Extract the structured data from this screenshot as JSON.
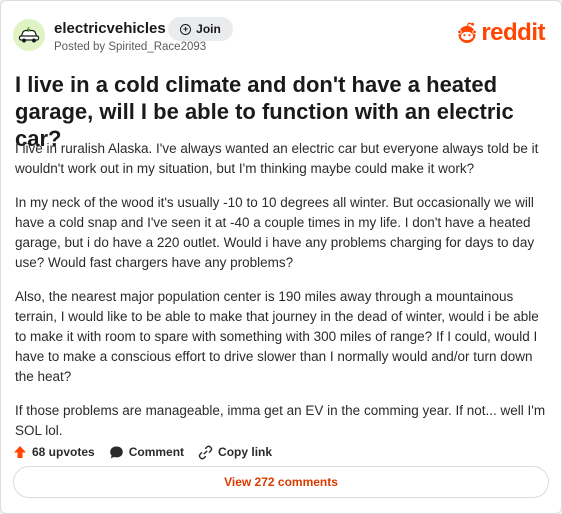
{
  "header": {
    "subreddit": "electricvehicles",
    "posted_by": "Posted by Spirited_Race2093",
    "join_label": "Join",
    "brand_word": "reddit"
  },
  "post": {
    "title": "I live in a cold climate and don't have a heated garage, will I be able to function with an electric car?",
    "paragraphs": [
      "I live in ruralish Alaska. I've always wanted an electric car but everyone always told be it wouldn't work out in my situation, but I'm thinking maybe could make it work?",
      "In my neck of the wood it's usually -10 to 10 degrees all winter. But occasionally we will have a cold snap and I've seen it at -40 a couple times in my life. I don't have a heated garage, but i do have a 220 outlet. Would i have any problems charging for days to day use? Would fast chargers have any problems?",
      "Also, the nearest major population center is 190 miles away through a mountainous terrain, I would like to be able to make that journey in the dead of winter, would i be able to make it with room to spare with something with 300 miles of range? If I could, would I have to make a conscious effort to drive slower than I normally would and/or turn down the heat?",
      "If those problems are manageable, imma get an EV in the comming year. If not... well I'm SOL lol."
    ]
  },
  "actions": {
    "upvotes_label": "68 upvotes",
    "comment_label": "Comment",
    "copy_link_label": "Copy link",
    "view_comments_label": "View 272 comments"
  },
  "colors": {
    "brand": "#ff4500",
    "upvote": "#ff4500",
    "view_comments": "#d93a00"
  },
  "icons": {
    "avatar": "ev-car-icon",
    "join": "plus-circle-icon",
    "brand": "reddit-alien-icon",
    "upvote": "upvote-arrow-icon",
    "comment": "comment-bubble-icon",
    "copy": "link-icon"
  }
}
